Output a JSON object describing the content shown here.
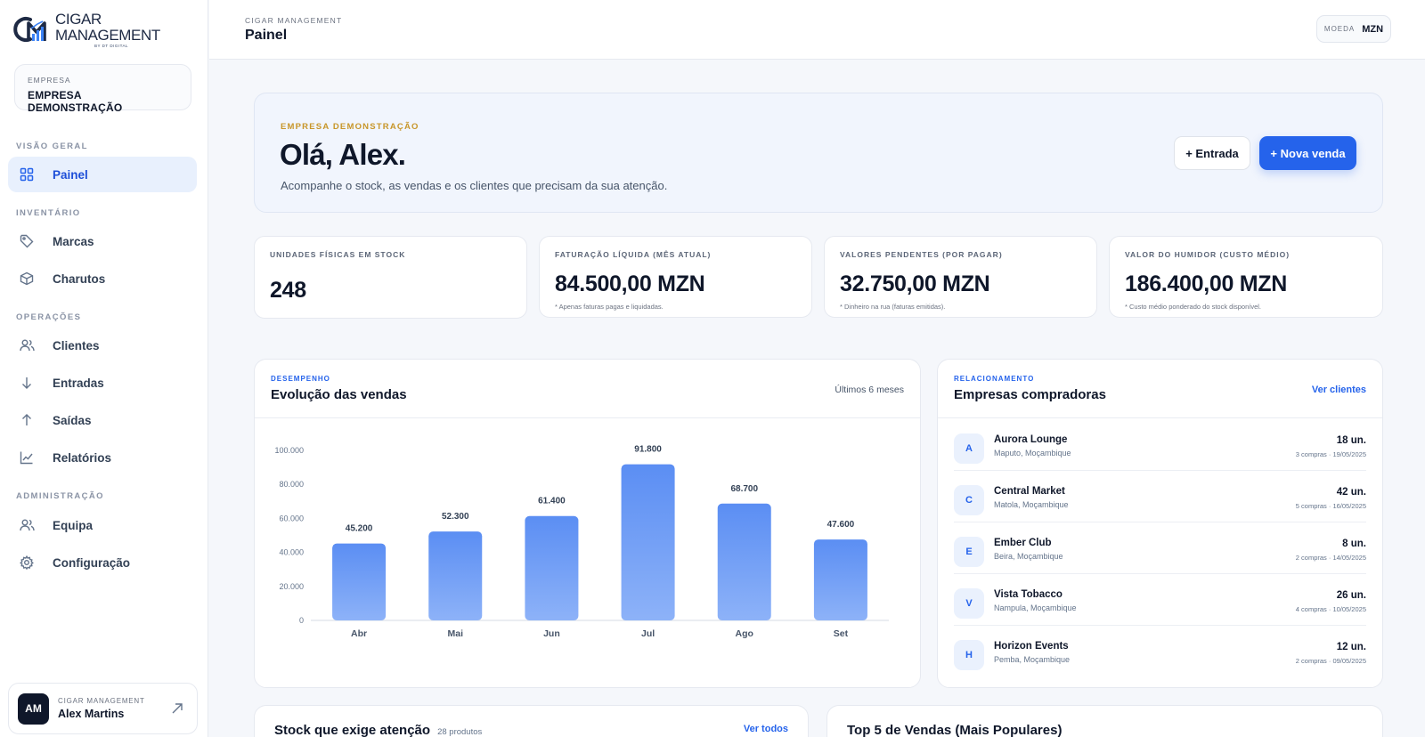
{
  "brand": {
    "title": "CIGAR MANAGEMENT",
    "subtitle": "BY DT DIGITAL",
    "colors": {
      "accent": "#2563eb",
      "gold": "#c8962a",
      "dark": "#0f172a"
    }
  },
  "company_box": {
    "label": "EMPRESA",
    "name": "EMPRESA DEMONSTRAÇÃO"
  },
  "nav": {
    "sections": {
      "overview": "VISÃO GERAL",
      "inventory": "INVENTÁRIO",
      "operations": "OPERAÇÕES",
      "admin": "ADMINISTRAÇÃO"
    },
    "items": {
      "painel": "Painel",
      "marcas": "Marcas",
      "charutos": "Charutos",
      "clientes": "Clientes",
      "entradas": "Entradas",
      "saidas": "Saídas",
      "relatorios": "Relatórios",
      "equipa": "Equipa",
      "configuracao": "Configuração"
    }
  },
  "user": {
    "initials": "AM",
    "app": "CIGAR MANAGEMENT",
    "name": "Alex Martins"
  },
  "topbar": {
    "crumb": "CIGAR MANAGEMENT",
    "title": "Painel",
    "currency_label": "MOEDA",
    "currency_value": "MZN"
  },
  "hero": {
    "company": "EMPRESA DEMONSTRAÇÃO",
    "greeting": "Olá, Alex.",
    "subtitle": "Acompanhe o stock, as vendas e os clientes que precisam da sua atenção.",
    "btn_entrada": "+ Entrada",
    "btn_nova_venda": "+ Nova venda"
  },
  "kpis": [
    {
      "label": "UNIDADES FÍSICAS EM STOCK",
      "value": "248",
      "note": ""
    },
    {
      "label": "FATURAÇÃO LÍQUIDA (MÊS ATUAL)",
      "value": "84.500,00 MZN",
      "note": "* Apenas faturas pagas e liquidadas."
    },
    {
      "label": "VALORES PENDENTES (POR PAGAR)",
      "value": "32.750,00 MZN",
      "note": "* Dinheiro na rua (faturas emitidas)."
    },
    {
      "label": "VALOR DO HUMIDOR (CUSTO MÉDIO)",
      "value": "186.400,00 MZN",
      "note": "* Custo médio ponderado do stock disponível."
    }
  ],
  "sales_card": {
    "kicker": "DESEMPENHO",
    "title": "Evolução das vendas",
    "range": "Últimos 6 meses"
  },
  "chart_data": {
    "type": "bar",
    "categories": [
      "Abr",
      "Mai",
      "Jun",
      "Jul",
      "Ago",
      "Set"
    ],
    "values": [
      45200,
      52300,
      61400,
      91800,
      68700,
      47600
    ],
    "value_labels": [
      "45.200",
      "52.300",
      "61.400",
      "91.800",
      "68.700",
      "47.600"
    ],
    "yticks": [
      0,
      20000,
      40000,
      60000,
      80000,
      100000
    ],
    "ytick_labels": [
      "0",
      "20.000",
      "40.000",
      "60.000",
      "80.000",
      "100.000"
    ],
    "ylim": [
      0,
      100000
    ],
    "bar_color": "#6b9bf5",
    "grid": false
  },
  "buyers_card": {
    "kicker": "RELACIONAMENTO",
    "title": "Empresas compradoras",
    "link": "Ver clientes",
    "rows": [
      {
        "initial": "A",
        "name": "Aurora Lounge",
        "location": "Maputo, Moçambique",
        "units": "18 un.",
        "meta": "3 compras · 19/05/2025"
      },
      {
        "initial": "C",
        "name": "Central Market",
        "location": "Matola, Moçambique",
        "units": "42 un.",
        "meta": "5 compras · 16/05/2025"
      },
      {
        "initial": "E",
        "name": "Ember Club",
        "location": "Beira, Moçambique",
        "units": "8 un.",
        "meta": "2 compras · 14/05/2025"
      },
      {
        "initial": "V",
        "name": "Vista Tobacco",
        "location": "Nampula, Moçambique",
        "units": "26 un.",
        "meta": "4 compras · 10/05/2025"
      },
      {
        "initial": "H",
        "name": "Horizon Events",
        "location": "Pemba, Moçambique",
        "units": "12 un.",
        "meta": "2 compras · 09/05/2025"
      }
    ]
  },
  "stock_card": {
    "title": "Stock que exige atenção",
    "count": "28 produtos",
    "link": "Ver todos"
  },
  "top_card": {
    "title": "Top 5 de Vendas (Mais Populares)"
  }
}
